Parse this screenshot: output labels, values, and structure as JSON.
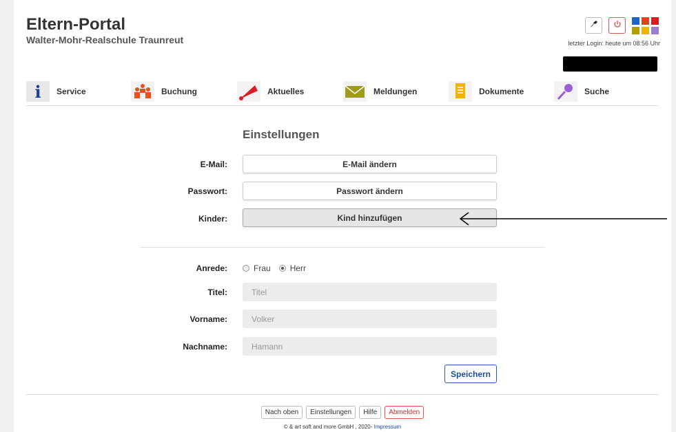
{
  "header": {
    "title": "Eltern-Portal",
    "school": "Walter-Mohr-Realschule Traunreut",
    "last_login": "letzter Login: heute um 08:56 Uhr",
    "tools": [
      "wrench-icon",
      "power-icon",
      "app-grid-icon"
    ]
  },
  "nav": {
    "items": [
      {
        "label": "Service",
        "icon": "info-icon"
      },
      {
        "label": "Buchung",
        "icon": "people-icon"
      },
      {
        "label": "Aktuelles",
        "icon": "megaphone-icon"
      },
      {
        "label": "Meldungen",
        "icon": "envelope-icon"
      },
      {
        "label": "Dokumente",
        "icon": "document-icon"
      },
      {
        "label": "Suche",
        "icon": "magnifier-icon"
      }
    ]
  },
  "settings": {
    "title": "Einstellungen",
    "email_label": "E-Mail:",
    "email_button": "E-Mail ändern",
    "password_label": "Passwort:",
    "password_button": "Passwort ändern",
    "children_label": "Kinder:",
    "children_button": "Kind hinzufügen"
  },
  "profile": {
    "salutation_label": "Anrede:",
    "salutation_options": [
      "Frau",
      "Herr"
    ],
    "salutation_selected": "Herr",
    "title_label": "Titel:",
    "title_placeholder": "Titel",
    "firstname_label": "Vorname:",
    "firstname_value": "Volker",
    "lastname_label": "Nachname:",
    "lastname_value": "Hamann",
    "save_label": "Speichern"
  },
  "footer": {
    "links": [
      "Nach oben",
      "Einstellungen",
      "Hilfe",
      "Abmelden"
    ],
    "copyright": "© & art soft and more GmbH , 2020-",
    "impressum": "Impressum"
  },
  "colors": {
    "accent_blue": "#1a4c9c",
    "logout_red": "#c9302c"
  }
}
